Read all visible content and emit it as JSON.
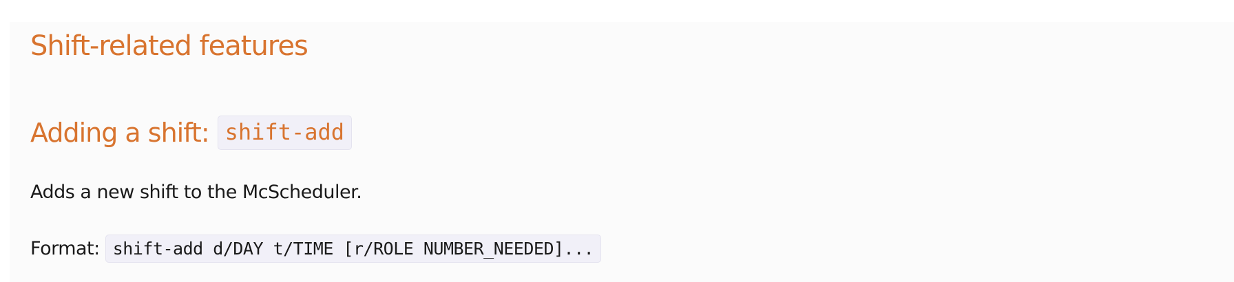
{
  "section": {
    "title": "Shift-related features"
  },
  "subsection": {
    "title_prefix": "Adding a shift:",
    "command": "shift-add",
    "description": "Adds a new shift to the McScheduler.",
    "format_label": "Format:",
    "format_code": "shift-add d/DAY t/TIME [r/ROLE NUMBER_NEEDED]..."
  },
  "colors": {
    "heading": "#d8742f",
    "code_background": "#f1f0f8",
    "body_text": "#1a1a1a",
    "page_background": "#fbfbfb"
  }
}
